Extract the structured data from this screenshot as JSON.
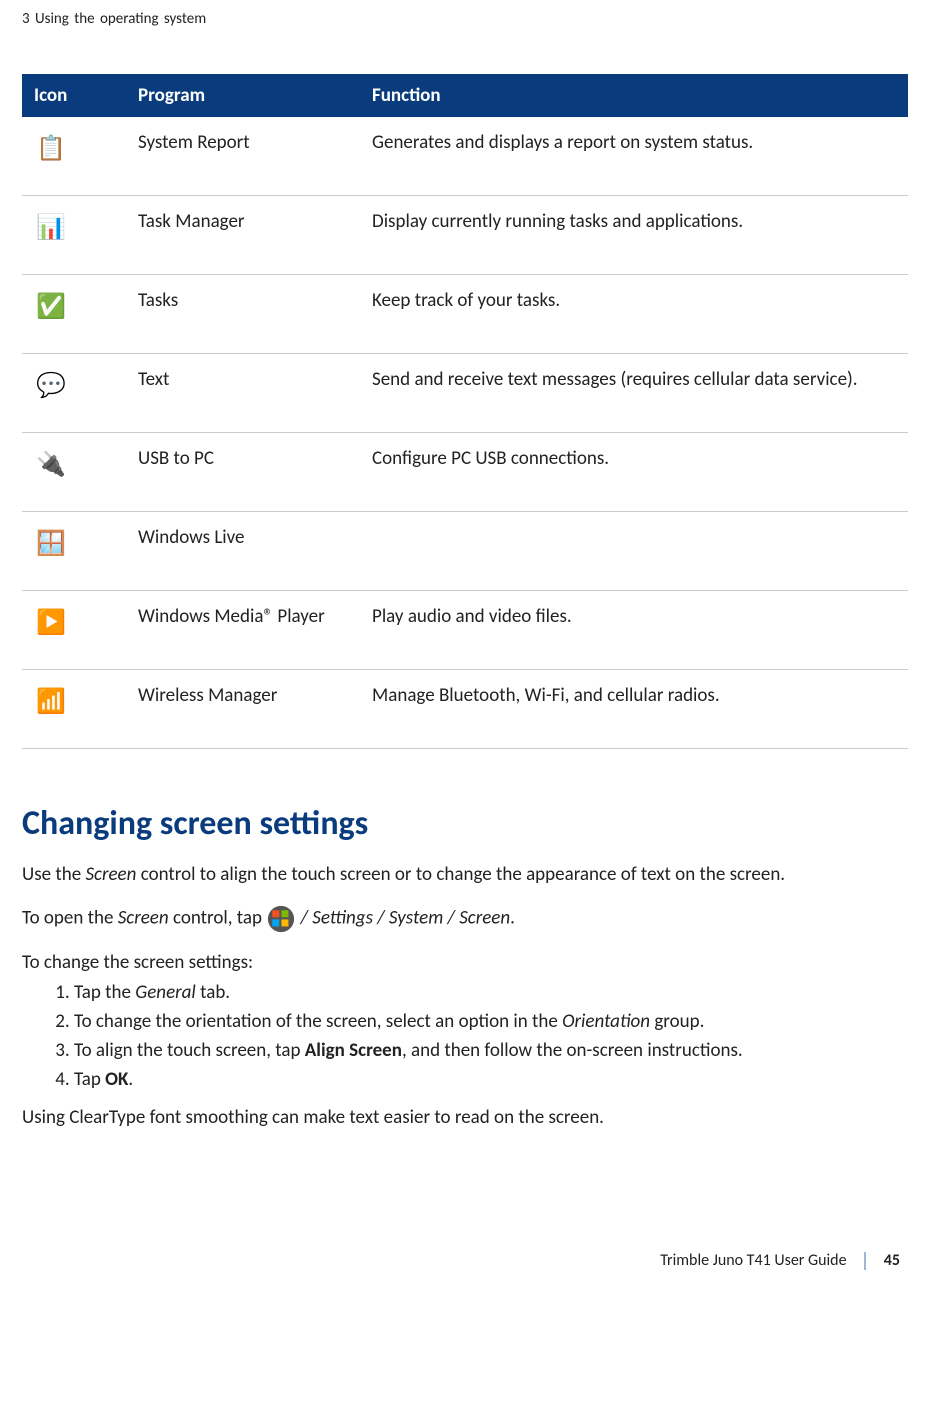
{
  "running_head": "3   Using the  operating system",
  "table": {
    "headers": {
      "icon": "Icon",
      "program": "Program",
      "function": "Function"
    },
    "rows": [
      {
        "icon": "system-report-icon",
        "icon_glyph": "📋",
        "program": "System Report",
        "function": "Generates and displays a report on system status."
      },
      {
        "icon": "task-manager-icon",
        "icon_glyph": "📊",
        "program": "Task Manager",
        "function": "Display currently running tasks and applications."
      },
      {
        "icon": "tasks-icon",
        "icon_glyph": "✅",
        "program": "Tasks",
        "function": "Keep track of your tasks."
      },
      {
        "icon": "text-icon",
        "icon_glyph": "💬",
        "program": "Text",
        "function": "Send and receive text messages (requires cellular data service)."
      },
      {
        "icon": "usb-to-pc-icon",
        "icon_glyph": "🔌",
        "program": "USB to PC",
        "function": "Configure PC USB connections."
      },
      {
        "icon": "windows-live-icon",
        "icon_glyph": "🪟",
        "program": "Windows Live",
        "function": ""
      },
      {
        "icon": "media-player-icon",
        "icon_glyph": "▶️",
        "program": "Windows Media® Player",
        "function": "Play audio and video files."
      },
      {
        "icon": "wireless-manager-icon",
        "icon_glyph": "📶",
        "program": "Wireless Manager",
        "function": "Manage Bluetooth, Wi-Fi, and cellular radios."
      }
    ]
  },
  "section_heading": "Changing screen settings",
  "para_1_a": "Use the ",
  "para_1_b": "Screen",
  "para_1_c": " control to align the touch screen or to change the appearance of text on the screen.",
  "para_2_a": "To open the ",
  "para_2_b": "Screen",
  "para_2_c": " control, tap ",
  "para_2_d": " / Settings / System / Screen",
  "para_2_e": ".",
  "para_3": "To change the screen settings:",
  "steps": {
    "s1_a": "Tap the ",
    "s1_b": "General",
    "s1_c": " tab.",
    "s2_a": "To change the orientation of the screen, select an option in the ",
    "s2_b": "Orientation",
    "s2_c": " group.",
    "s3_a": "To align the touch screen, tap ",
    "s3_b": "Align Screen",
    "s3_c": ", and then follow the on-screen instructions.",
    "s4_a": "Tap ",
    "s4_b": "OK",
    "s4_c": "."
  },
  "para_4": "Using ClearType font smoothing can make text easier to read on the screen.",
  "footer": {
    "guide": "Trimble Juno T41 User Guide",
    "page": "45"
  }
}
